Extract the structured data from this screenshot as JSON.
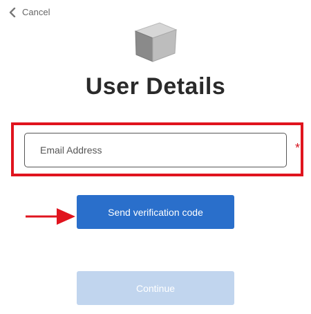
{
  "header": {
    "cancel_label": "Cancel",
    "back_icon": "chevron-left-icon",
    "logo_icon": "cube-icon"
  },
  "main": {
    "title": "User Details",
    "email_field": {
      "placeholder": "Email Address",
      "value": "",
      "required_marker": "*"
    },
    "send_button_label": "Send verification code",
    "continue_button_label": "Continue"
  },
  "annotations": {
    "highlight_color": "#e0141e",
    "arrow_color": "#e0141e"
  },
  "colors": {
    "primary": "#2a6fcb",
    "primary_disabled": "#c1d5ee",
    "title_text": "#2a2a2a",
    "required_mark": "#d5141e"
  }
}
